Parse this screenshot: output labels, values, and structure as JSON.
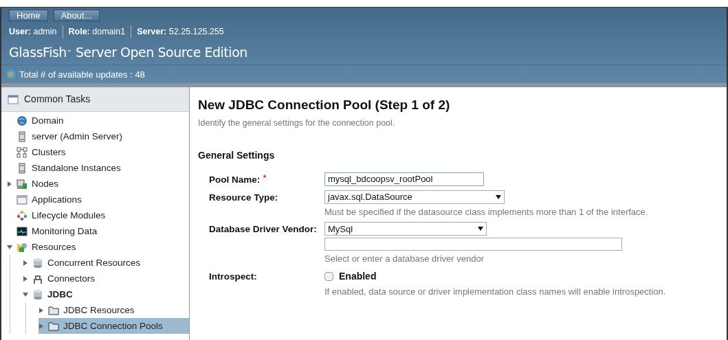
{
  "masthead": {
    "buttons": [
      "Home",
      "About..."
    ],
    "user_info": [
      {
        "label": "User:",
        "value": "admin"
      },
      {
        "label": "Role:",
        "value": "domain1"
      },
      {
        "label": "Server:",
        "value": "52.25.125.255"
      }
    ],
    "product_name": "GlassFish",
    "trademark": "™",
    "product_suffix": " Server Open Source Edition",
    "updates": "Total # of available updates : 48"
  },
  "sidebar": {
    "header": "Common Tasks",
    "items": [
      {
        "label": "Domain",
        "kind": "globe",
        "selected": false
      },
      {
        "label": "server (Admin Server)",
        "kind": "server",
        "selected": false
      },
      {
        "label": "Clusters",
        "kind": "cluster",
        "selected": false
      },
      {
        "label": "Standalone Instances",
        "kind": "server",
        "selected": false
      },
      {
        "label": "Nodes",
        "kind": "node",
        "selected": false,
        "expanded": false
      },
      {
        "label": "Applications",
        "kind": "app",
        "selected": false
      },
      {
        "label": "Lifecycle Modules",
        "kind": "lifecycle",
        "selected": false
      },
      {
        "label": "Monitoring Data",
        "kind": "monitor",
        "selected": false
      },
      {
        "label": "Resources",
        "kind": "resources",
        "selected": false,
        "expanded": true,
        "children": [
          {
            "label": "Concurrent Resources",
            "kind": "database",
            "selected": false,
            "expanded": false
          },
          {
            "label": "Connectors",
            "kind": "connector",
            "selected": false,
            "expanded": false
          },
          {
            "label": "JDBC",
            "kind": "database",
            "selected": false,
            "expanded": true,
            "children": [
              {
                "label": "JDBC Resources",
                "kind": "folder",
                "selected": false,
                "expanded": false
              },
              {
                "label": "JDBC Connection Pools",
                "kind": "folder",
                "selected": true,
                "expanded": false
              }
            ]
          }
        ]
      }
    ]
  },
  "page": {
    "title": "New JDBC Connection Pool (Step 1 of 2)",
    "description": "Identify the general settings for the connection pool.",
    "section": "General Settings",
    "fields": [
      {
        "kind": "text",
        "label": "Pool Name:",
        "required": true,
        "required_mark": "*",
        "value": "mysql_bdcoopsv_rootPool"
      },
      {
        "kind": "select",
        "label": "Resource Type:",
        "value": "javax.sql.DataSource",
        "help": "Must be specified if the datasource class implements more than 1 of the interface."
      },
      {
        "kind": "select_text",
        "label": "Database Driver Vendor:",
        "value": "MySql",
        "help": "Select or enter a database driver vendor"
      },
      {
        "kind": "checkbox",
        "label": "Introspect:",
        "option": "Enabled",
        "checked": false,
        "help": "If enabled, data source or driver implementation class names will enable introspection."
      }
    ]
  }
}
